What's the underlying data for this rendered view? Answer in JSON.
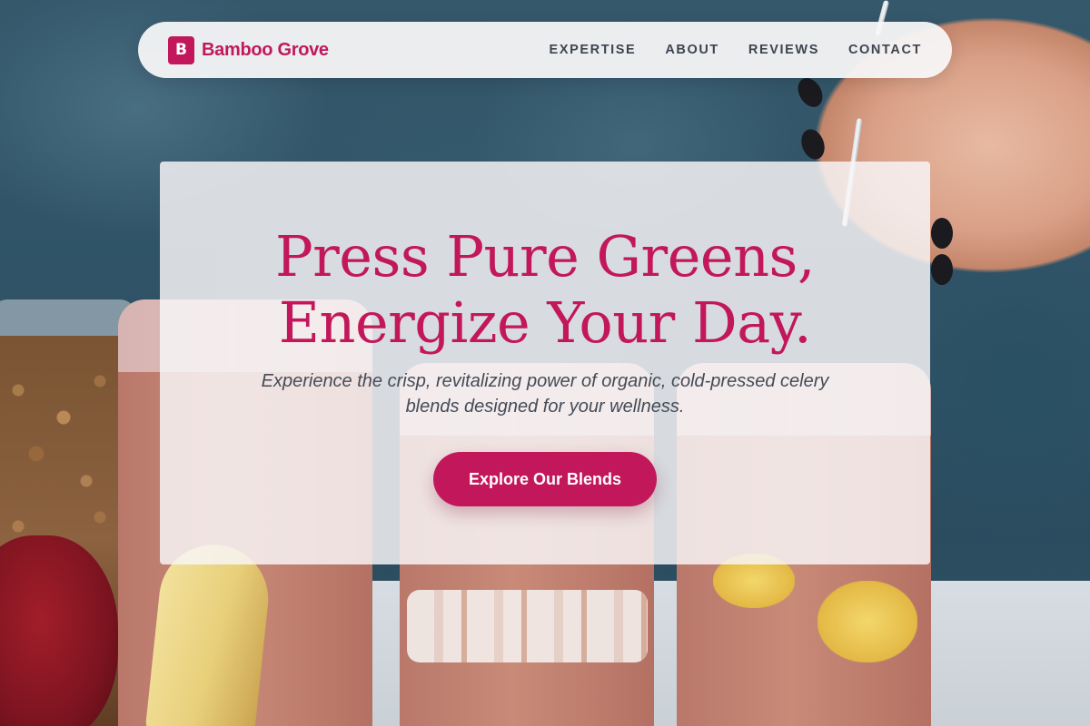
{
  "brand": {
    "mark": "B",
    "name": "Bamboo Grove"
  },
  "nav": {
    "items": [
      "EXPERTISE",
      "ABOUT",
      "REVIEWS",
      "CONTACT"
    ]
  },
  "hero": {
    "title_line1": "Press Pure Greens,",
    "title_line2": "Energize Your Day.",
    "subtitle_line1": "Experience the crisp, revitalizing power of organic, cold-pressed celery",
    "subtitle_line2": "blends designed for your wellness.",
    "cta_label": "Explore Our Blends"
  },
  "colors": {
    "accent": "#c2185b",
    "nav_text": "#3e4450",
    "subtitle_text": "#454b57"
  }
}
